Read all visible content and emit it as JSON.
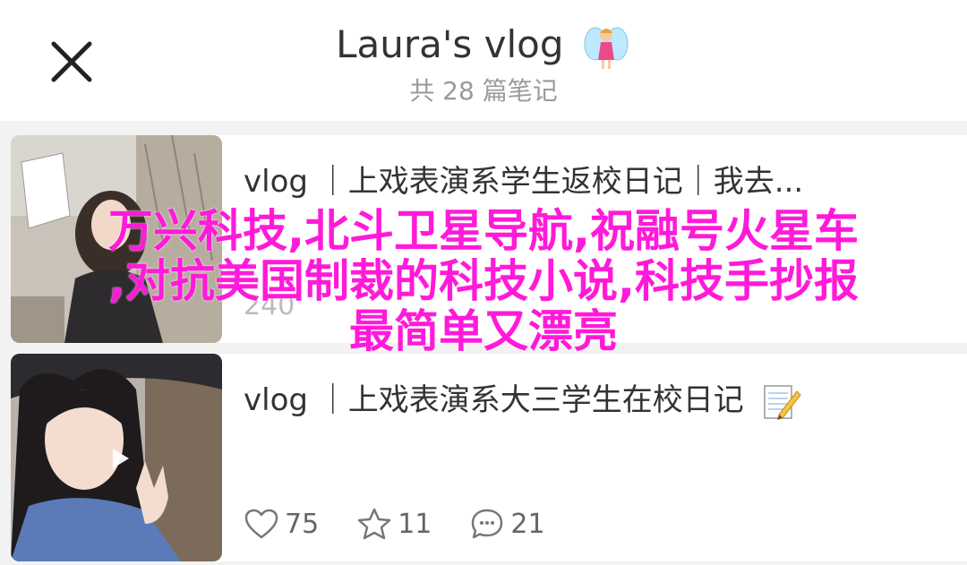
{
  "header": {
    "title": "Laura's vlog",
    "title_emoji": "fairy-emoji",
    "subtitle": "共 28 篇笔记",
    "close_icon": "close-icon"
  },
  "notes": [
    {
      "title": "vlog ｜上戏表演系学生返校日记｜我去...",
      "likes": "240",
      "has_video": false
    },
    {
      "title": "vlog ｜上戏表演系大三学生在校日记",
      "title_emoji": "memo-emoji",
      "likes": "75",
      "stars": "11",
      "comments": "21",
      "has_video": true
    }
  ],
  "overlay": {
    "line1": "万兴科技,北斗卫星导航,祝融号火星车",
    "line2": ",对抗美国制裁的科技小说,科技手抄报",
    "line3": "最简单又漂亮"
  },
  "colors": {
    "overlay_text": "#ff1ad9",
    "list_background": "#f2f2f2"
  }
}
